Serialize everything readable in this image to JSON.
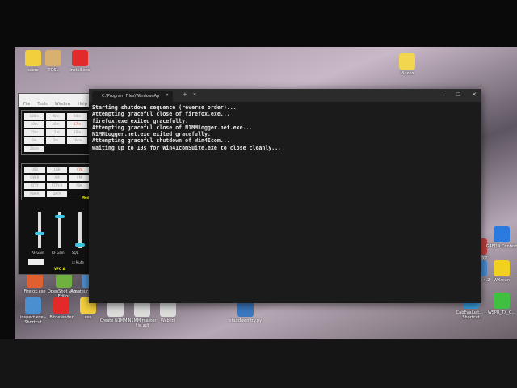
{
  "desktop_icons": [
    {
      "label": "score",
      "color": "#f2cf3c"
    },
    {
      "label": "TQSL",
      "color": "#d8b070"
    },
    {
      "label": "Install.exe",
      "color": "#e32a2a"
    },
    {
      "label": "Videos",
      "color": "#f2d650"
    },
    {
      "label": "Firefox.exe",
      "color": "#e06030"
    },
    {
      "label": "OpenShot Video Editor",
      "color": "#70b040"
    },
    {
      "label": "Amateur Contact L",
      "color": "#4f8fd0"
    },
    {
      "label": "inspect.exe - Shortcut",
      "color": "#4a90d0"
    },
    {
      "label": "Bitdefender",
      "color": "#e32a2a"
    },
    {
      "label": "exe",
      "color": "#f2cf3c"
    },
    {
      "label": "Create N1MM...",
      "color": "#ddd"
    },
    {
      "label": "N1MM master file.adf",
      "color": "#ddd"
    },
    {
      "label": "Web.ini",
      "color": "#ddd"
    },
    {
      "label": "shutdown try.py",
      "color": "#3a78c0"
    },
    {
      "label": "fldigi XP",
      "color": "#c04040"
    },
    {
      "label": "G4FON Contest",
      "color": "#2a7ae0"
    },
    {
      "label": "Sdamo 4.2",
      "color": "#4a8ad0"
    },
    {
      "label": "WXscan",
      "color": "#f2d020"
    },
    {
      "label": "CabEvaluat... - Shortcut",
      "color": "#3a9ee0"
    },
    {
      "label": "WSPR_TX_C...",
      "color": "#40c040"
    }
  ],
  "terminal": {
    "tab_title": "C:\\Program Files\\WindowsAp",
    "tab_close": "✕",
    "new_tab": "+",
    "dropdown": "⌄",
    "minimize": "—",
    "maximize": "☐",
    "close": "✕",
    "lines": [
      "Starting shutdown sequence (reverse order)...",
      "Attempting graceful close of firefox.exe...",
      "firefox.exe exited gracefully.",
      "Attempting graceful close of N1MMLogger.net.exe...",
      "N1MMLogger.net.exe exited gracefully.",
      "Attempting graceful shutdown of Win4Icom...",
      "Waiting up to 10s for Win4IcomSuite.exe to close cleanly..."
    ]
  },
  "radio": {
    "menu": [
      "File",
      "Tools",
      "Window",
      "Help"
    ],
    "bands": [
      "160m",
      "80m",
      "60m",
      "40m",
      "20m",
      "17m",
      "15m",
      "12m",
      "10m",
      "6m",
      "2m",
      "70cm",
      "23cm"
    ],
    "modes": [
      "USB",
      "LSB",
      "CW",
      "CW-R",
      "AM",
      "FM",
      "RTTY",
      "RTTY-R",
      "PSK",
      "PSK-R",
      "DATA"
    ],
    "mode_label": "Mode",
    "sliders": [
      {
        "label": "AF Gain",
        "level": 0.4
      },
      {
        "label": "RF Gain",
        "level": 0.9
      },
      {
        "label": "SQL",
        "level": 0.05
      }
    ],
    "mute_label": "Mute",
    "vfo_label": "VFO A"
  }
}
